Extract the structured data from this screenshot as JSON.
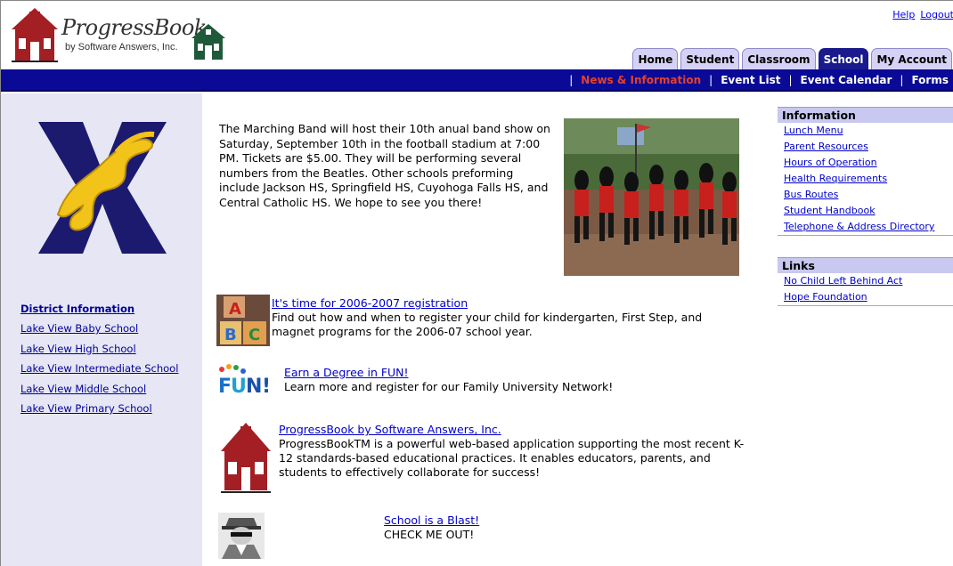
{
  "header": {
    "logo_title": "ProgressBook",
    "logo_subtitle": "by Software Answers, Inc.",
    "links": [
      "Help",
      "Logout"
    ]
  },
  "tabs": [
    {
      "label": "Home",
      "active": false
    },
    {
      "label": "Student",
      "active": false
    },
    {
      "label": "Classroom",
      "active": false
    },
    {
      "label": "School",
      "active": true
    },
    {
      "label": "My Account",
      "active": false
    }
  ],
  "subnav": {
    "items": [
      "News & Information",
      "Event List",
      "Event Calendar",
      "Forms"
    ],
    "current": "News & Information"
  },
  "sidebar": {
    "header": "District Information",
    "links": [
      "Lake View Baby School",
      "Lake View High School",
      "Lake View Intermediate School",
      "Lake View Middle School",
      "Lake View Primary School"
    ]
  },
  "main": {
    "announcement": "The Marching Band will host their 10th anual band show on Saturday, September 10th in the football stadium at 7:00 PM. Tickets are $5.00. They will be performing several numbers from the Beatles. Other schools preforming include Jackson HS, Springfield HS, Cuyohoga Falls HS, and Central Catholic HS. We hope to see you there!",
    "news": [
      {
        "title": "It's time for 2006-2007 registration",
        "body": "Find out how and when to register your child for kindergarten, First Step, and magnet programs for the 2006-07 school year.",
        "icon": "abc-blocks-icon"
      },
      {
        "title": "Earn a Degree in FUN!",
        "body": "Learn more and register for our Family University Network!",
        "icon": "fun-icon"
      },
      {
        "title": "ProgressBook by Software Answers, Inc.",
        "body": "ProgressBookTM is a powerful web-based application supporting the most recent K-12 standards-based educational practices. It enables educators, parents, and students to effectively collaborate for success!",
        "icon": "schoolhouse-icon"
      },
      {
        "title": "School is a Blast!",
        "body": "CHECK ME OUT!",
        "icon": "spy-icon"
      }
    ]
  },
  "right": {
    "information": {
      "title": "Information",
      "links": [
        "Lunch Menu",
        "Parent Resources",
        "Hours of Operation",
        "Health Requirements",
        "Bus Routes",
        "Student Handbook",
        "Telephone & Address Directory"
      ]
    },
    "links_panel": {
      "title": "Links",
      "links": [
        "No Child Left Behind Act",
        "Hope Foundation"
      ]
    }
  },
  "colors": {
    "nav_bar": "#0a0a96",
    "active_tab": "#1a1a8c",
    "tab": "#d6d2f6",
    "sidebar": "#e6e6f4",
    "panel_header": "#c8c8f0",
    "current_nav": "#e4412c",
    "link": "#0000cc"
  }
}
